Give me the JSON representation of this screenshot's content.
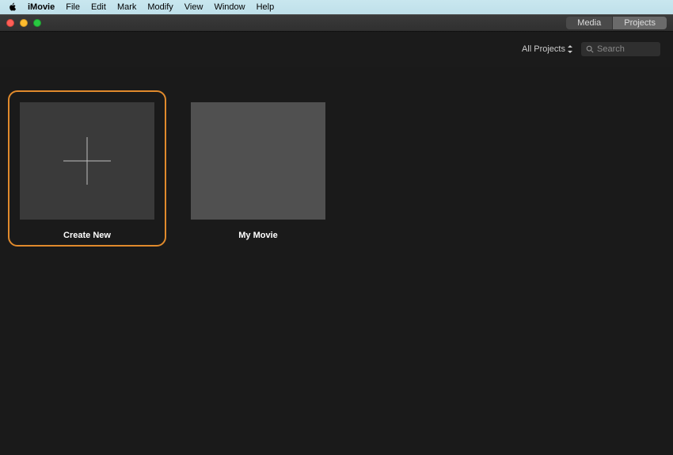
{
  "menubar": {
    "app": "iMovie",
    "items": [
      "File",
      "Edit",
      "Mark",
      "Modify",
      "View",
      "Window",
      "Help"
    ]
  },
  "titlebar": {
    "segments": {
      "media": "Media",
      "projects": "Projects"
    },
    "active_segment": "projects"
  },
  "toolbar": {
    "filter_label": "All Projects",
    "search_placeholder": "Search"
  },
  "projects": {
    "create_new_label": "Create New",
    "items": [
      {
        "title": "My Movie"
      }
    ]
  }
}
